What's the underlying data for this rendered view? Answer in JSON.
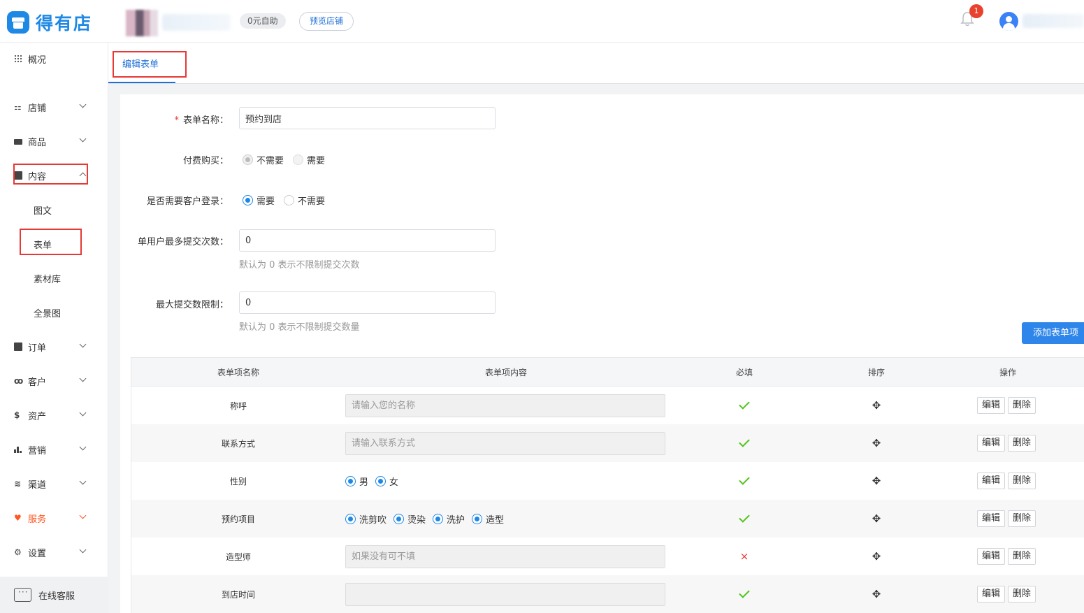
{
  "header": {
    "brand": "得有店",
    "plan_badge": "0元自助",
    "preview_button": "预览店铺",
    "notification_count": "1"
  },
  "sidebar": {
    "overview": "概况",
    "items": [
      {
        "label": "店铺"
      },
      {
        "label": "商品"
      },
      {
        "label": "内容"
      },
      {
        "label": "订单"
      },
      {
        "label": "客户"
      },
      {
        "label": "资产"
      },
      {
        "label": "营销"
      },
      {
        "label": "渠道"
      },
      {
        "label": "服务"
      },
      {
        "label": "设置"
      }
    ],
    "content_sub": [
      {
        "label": "图文"
      },
      {
        "label": "表单"
      },
      {
        "label": "素材库"
      },
      {
        "label": "全景图"
      }
    ],
    "support": "在线客服"
  },
  "tabs": {
    "edit_form": "编辑表单"
  },
  "form": {
    "name_label": "表单名称：",
    "name_value": "预约到店",
    "paid_label": "付费购买：",
    "paid_options": [
      "不需要",
      "需要"
    ],
    "login_label": "是否需要客户登录：",
    "login_options": [
      "需要",
      "不需要"
    ],
    "max_per_user_label": "单用户最多提交次数：",
    "max_per_user_value": "0",
    "max_per_user_hint": "默认为 0 表示不限制提交次数",
    "max_total_label": "最大提交数限制：",
    "max_total_value": "0",
    "max_total_hint": "默认为 0 表示不限制提交数量",
    "add_item_button": "添加表单项"
  },
  "table": {
    "headers": [
      "表单项名称",
      "表单项内容",
      "必填",
      "排序",
      "操作"
    ],
    "edit_label": "编辑",
    "delete_label": "删除",
    "rows": [
      {
        "name": "称呼",
        "placeholder": "请输入您的名称"
      },
      {
        "name": "联系方式",
        "placeholder": "请输入联系方式"
      },
      {
        "name": "性别",
        "options": [
          "男",
          "女"
        ]
      },
      {
        "name": "预约项目",
        "options": [
          "洗剪吹",
          "烫染",
          "洗护",
          "造型"
        ]
      },
      {
        "name": "造型师",
        "placeholder": "如果没有可不填"
      },
      {
        "name": "到店时间",
        "placeholder": ""
      }
    ]
  }
}
